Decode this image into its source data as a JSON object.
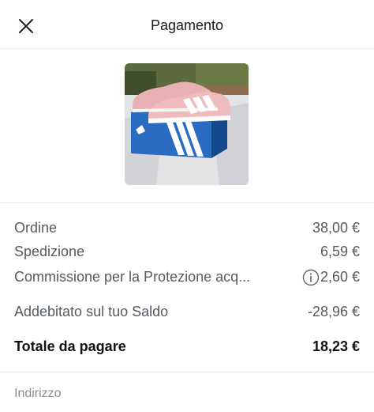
{
  "header": {
    "title": "Pagamento",
    "close_icon": "close-icon"
  },
  "product": {
    "image": "product-photo"
  },
  "summary": {
    "order": {
      "label": "Ordine",
      "value": "38,00 €"
    },
    "shipping": {
      "label": "Spedizione",
      "value": "6,59 €"
    },
    "protection_fee": {
      "label": "Commissione per la Protezione acq...",
      "value": "2,60 €",
      "icon": "info-icon"
    },
    "balance": {
      "label": "Addebitato sul tuo Saldo",
      "value": "-28,96 €"
    },
    "total": {
      "label": "Totale da pagare",
      "value": "18,23 €"
    }
  },
  "address": {
    "label": "Indirizzo"
  }
}
